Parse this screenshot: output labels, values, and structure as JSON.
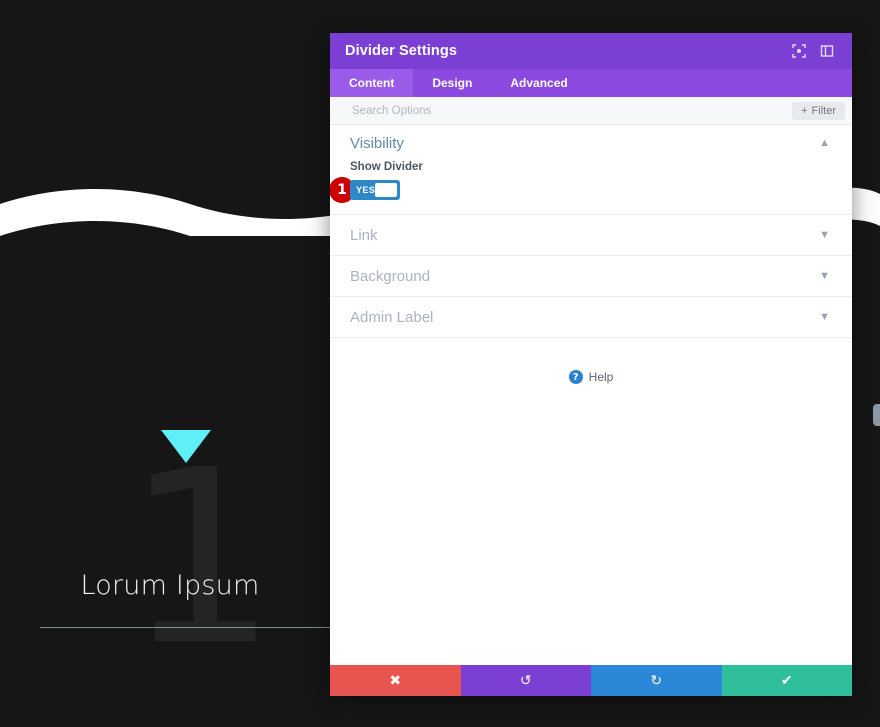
{
  "background": {
    "hero": {
      "triangle_icon": "triangle-down-icon",
      "watermark_number": "1",
      "title": "Lorum Ipsum",
      "triangle_color": "#5ff0f7",
      "rule_color": "#9fb6bd"
    },
    "divider": {
      "shape_name": "wave-divider",
      "color": "#ffffff"
    },
    "page_bg_color": "#161616"
  },
  "modal": {
    "header": {
      "title": "Divider Settings",
      "bg_color": "#7b3fd3",
      "icons": [
        {
          "name": "fullscreen-icon",
          "glyph": "expand"
        },
        {
          "name": "layout-toggle-icon",
          "glyph": "panel"
        }
      ]
    },
    "tabs": [
      {
        "label": "Content",
        "active": true
      },
      {
        "label": "Design",
        "active": false
      },
      {
        "label": "Advanced",
        "active": false
      }
    ],
    "search": {
      "placeholder": "Search Options",
      "value": "",
      "filter_label": "Filter",
      "filter_plus": "+"
    },
    "sections": {
      "open": {
        "title": "Visibility",
        "chevron": "chevron-up",
        "field": {
          "label": "Show Divider",
          "toggle_value": "YES",
          "toggle_color": "#2d87c8",
          "step_number": "1",
          "step_color": "#cc0000"
        }
      },
      "closed": [
        {
          "title": "Link",
          "chevron": "chevron-down"
        },
        {
          "title": "Background",
          "chevron": "chevron-down"
        },
        {
          "title": "Admin Label",
          "chevron": "chevron-down"
        }
      ]
    },
    "help": {
      "label": "Help",
      "icon_glyph": "?"
    },
    "footer_buttons": [
      {
        "name": "cancel",
        "glyph": "✖",
        "color": "#e8544f"
      },
      {
        "name": "undo",
        "glyph": "↺",
        "color": "#7b3fd3"
      },
      {
        "name": "redo",
        "glyph": "↻",
        "color": "#2b87d8"
      },
      {
        "name": "save",
        "glyph": "✔",
        "color": "#2fbf9b"
      }
    ]
  }
}
